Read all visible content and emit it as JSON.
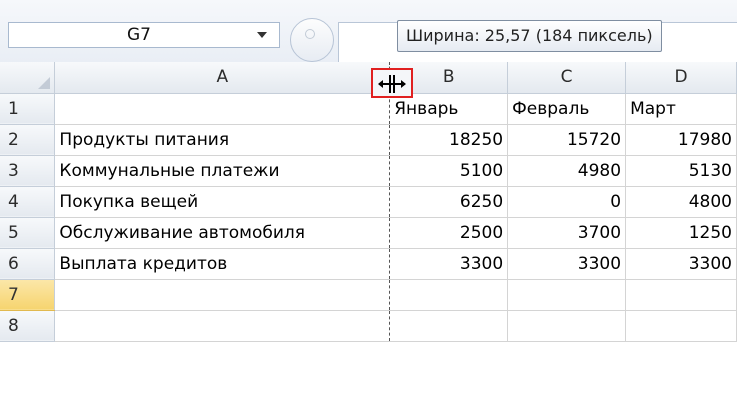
{
  "formula_bar": {
    "name_box": "G7",
    "tooltip": "Ширина: 25,57 (184 пиксель)"
  },
  "columns": [
    "A",
    "B",
    "C",
    "D"
  ],
  "rows": [
    {
      "num": "1",
      "cells": [
        "",
        "Январь",
        "Февраль",
        "Март"
      ]
    },
    {
      "num": "2",
      "cells": [
        "Продукты питания",
        "18250",
        "15720",
        "17980"
      ]
    },
    {
      "num": "3",
      "cells": [
        "Коммунальные платежи",
        "5100",
        "4980",
        "5130"
      ]
    },
    {
      "num": "4",
      "cells": [
        "Покупка вещей",
        "6250",
        "0",
        "4800"
      ]
    },
    {
      "num": "5",
      "cells": [
        "Обслуживание автомобиля",
        "2500",
        "3700",
        "1250"
      ]
    },
    {
      "num": "6",
      "cells": [
        "Выплата кредитов",
        "3300",
        "3300",
        "3300"
      ]
    },
    {
      "num": "7",
      "cells": [
        "",
        "",
        "",
        ""
      ]
    },
    {
      "num": "8",
      "cells": [
        "",
        "",
        "",
        ""
      ]
    }
  ],
  "icons": {
    "resize_cursor": "column-resize-icon",
    "name_box_dropdown": "chevron-down-icon",
    "formula_button": "fx-icon"
  },
  "colors": {
    "highlight_border": "#e02020",
    "active_row_header": "#f6d46f"
  }
}
